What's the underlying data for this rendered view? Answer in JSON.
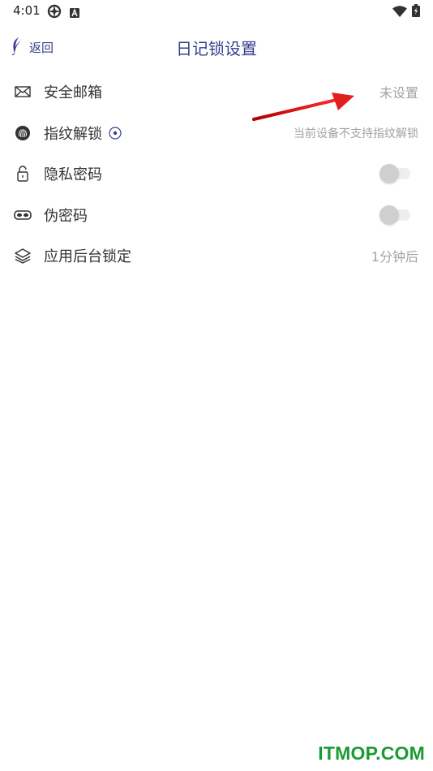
{
  "status_bar": {
    "time": "4:01",
    "icons": [
      "settings-shield-icon",
      "a-badge-icon",
      "wifi-icon",
      "battery-charging-icon"
    ]
  },
  "nav": {
    "back_label": "返回",
    "back_icon": "feather-back-icon",
    "title": "日记锁设置",
    "accent_color": "#3b3f8f"
  },
  "settings": [
    {
      "icon": "envelope-icon",
      "label": "安全邮箱",
      "value": "未设置"
    },
    {
      "icon": "fingerprint-icon",
      "label": "指纹解锁",
      "info_icon": "info-circle-icon",
      "value": "当前设备不支持指纹解锁"
    },
    {
      "icon": "lock-icon",
      "label": "隐私密码",
      "toggle_on": false
    },
    {
      "icon": "mask-icon",
      "label": "伪密码",
      "toggle_on": false
    },
    {
      "icon": "layers-icon",
      "label": "应用后台锁定",
      "value": "1分钟后"
    }
  ],
  "annotation": {
    "type": "arrow",
    "color": "#e02020"
  },
  "watermark": {
    "text": "ITMOP.COM",
    "color": "#1a9a33"
  }
}
